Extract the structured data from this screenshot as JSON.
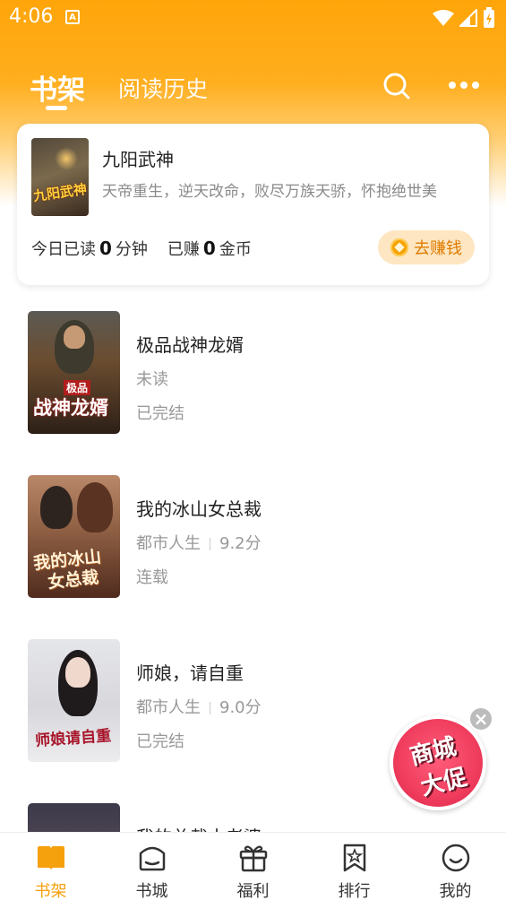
{
  "status_bar": {
    "time": "4:06",
    "notification_icon": "A"
  },
  "header": {
    "tabs": [
      {
        "label": "书架",
        "active": true
      },
      {
        "label": "阅读历史",
        "active": false
      }
    ],
    "search_icon": "search-icon",
    "more_icon": "more-icon"
  },
  "continue_reading": {
    "cover_text": "九阳武神",
    "title": "九阳武神",
    "description": "天帝重生，逆天改命，败尽万族天骄，怀抱绝世美",
    "stats": {
      "read_label": "今日已读",
      "read_value": "0",
      "read_unit": "分钟",
      "earned_label": "已赚",
      "earned_value": "0",
      "earned_unit": "金币"
    },
    "earn_button": "去赚钱"
  },
  "books": [
    {
      "title": "极品战神龙婿",
      "meta1": "未读",
      "meta2": "",
      "status": "已完结",
      "cover_text_a": "极品",
      "cover_text_b": "战神龙婿"
    },
    {
      "title": "我的冰山女总裁",
      "meta1": "都市人生",
      "meta2": "9.2分",
      "status": "连载",
      "cover_text_a": "我的冰山",
      "cover_text_b": "女总裁"
    },
    {
      "title": "师娘，请自重",
      "meta1": "都市人生",
      "meta2": "9.0分",
      "status": "已完结",
      "cover_text_a": "师娘请自重",
      "cover_text_b": ""
    },
    {
      "title": "我的总裁大老婆",
      "meta1": "",
      "meta2": "",
      "status": "",
      "cover_text_a": "",
      "cover_text_b": ""
    }
  ],
  "promo": {
    "line1": "商城",
    "line2": "大促",
    "close": "×"
  },
  "bottom_nav": [
    {
      "label": "书架",
      "icon": "bookshelf-icon",
      "active": true
    },
    {
      "label": "书城",
      "icon": "bookstore-icon",
      "active": false
    },
    {
      "label": "福利",
      "icon": "gift-icon",
      "active": false
    },
    {
      "label": "排行",
      "icon": "ranking-icon",
      "active": false
    },
    {
      "label": "我的",
      "icon": "profile-icon",
      "active": false
    }
  ],
  "colors": {
    "accent": "#f5a00d",
    "header_bg": "#ffa50a",
    "promo": "#f03d5e"
  }
}
